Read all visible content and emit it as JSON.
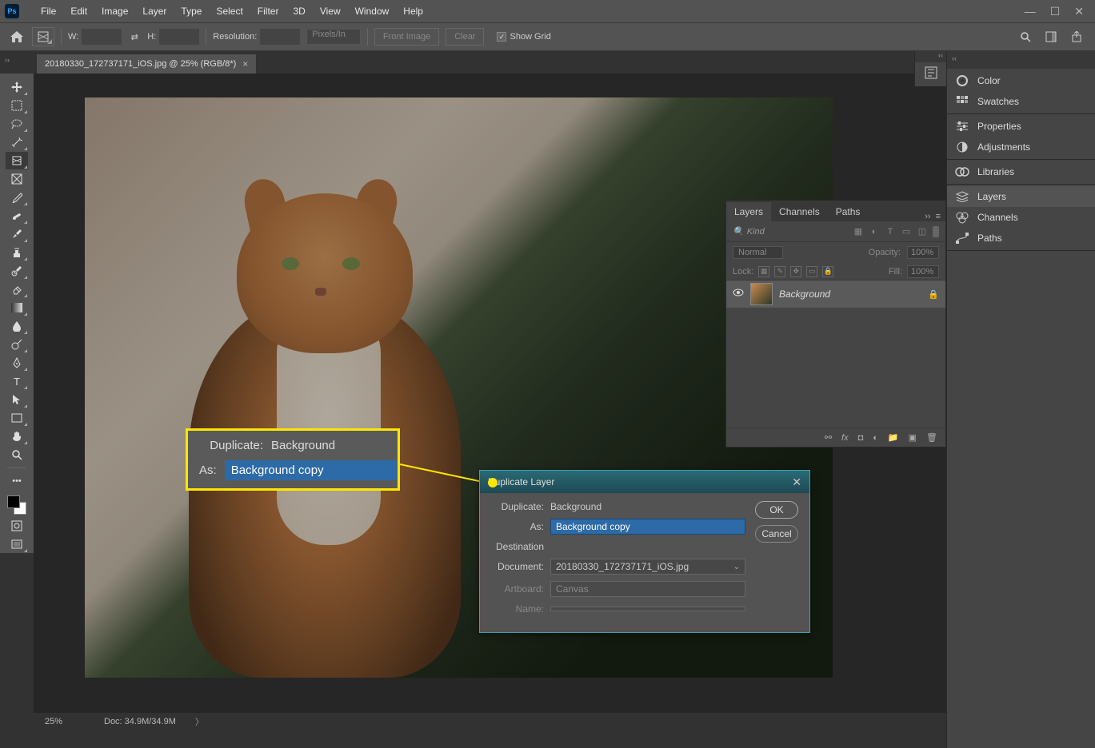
{
  "app": {
    "logo": "Ps"
  },
  "menu": [
    "File",
    "Edit",
    "Image",
    "Layer",
    "Type",
    "Select",
    "Filter",
    "3D",
    "View",
    "Window",
    "Help"
  ],
  "optionsbar": {
    "w_label": "W:",
    "h_label": "H:",
    "res_label": "Resolution:",
    "unit": "Pixels/In",
    "front_image": "Front Image",
    "clear": "Clear",
    "show_grid": "Show Grid"
  },
  "document": {
    "tab_title": "20180330_172737171_iOS.jpg @ 25% (RGB/8*)"
  },
  "status": {
    "zoom": "25%",
    "doc": "Doc: 34.9M/34.9M"
  },
  "right_rail": {
    "groups": [
      [
        {
          "icon": "color-wheel",
          "label": "Color"
        },
        {
          "icon": "swatches",
          "label": "Swatches"
        }
      ],
      [
        {
          "icon": "properties",
          "label": "Properties"
        },
        {
          "icon": "adjustments",
          "label": "Adjustments"
        }
      ],
      [
        {
          "icon": "cc",
          "label": "Libraries"
        }
      ],
      [
        {
          "icon": "layers",
          "label": "Layers",
          "active": true
        },
        {
          "icon": "channels",
          "label": "Channels"
        },
        {
          "icon": "paths",
          "label": "Paths"
        }
      ]
    ]
  },
  "layers_panel": {
    "tabs": [
      "Layers",
      "Channels",
      "Paths"
    ],
    "kind_placeholder": "Kind",
    "blend": "Normal",
    "opacity_label": "Opacity:",
    "opacity": "100%",
    "lock_label": "Lock:",
    "fill_label": "Fill:",
    "fill": "100%",
    "layer_name": "Background"
  },
  "callout": {
    "duplicate_label": "Duplicate:",
    "duplicate_value": "Background",
    "as_label": "As:",
    "as_value": "Background copy"
  },
  "dialog": {
    "title": "Duplicate Layer",
    "duplicate_label": "Duplicate:",
    "duplicate_value": "Background",
    "as_label": "As:",
    "as_value": "Background copy",
    "destination_label": "Destination",
    "document_label": "Document:",
    "document_value": "20180330_172737171_iOS.jpg",
    "artboard_label": "Artboard:",
    "artboard_value": "Canvas",
    "name_label": "Name:",
    "ok": "OK",
    "cancel": "Cancel"
  }
}
